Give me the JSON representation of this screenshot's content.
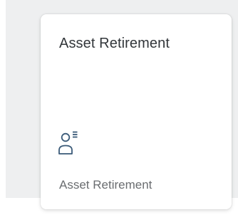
{
  "tile": {
    "title": "Asset Retirement",
    "footer": "Asset Retirement",
    "icon": "user-list-icon"
  },
  "colors": {
    "background": "#eeeff0",
    "tile": "#ffffff",
    "title": "#32363a",
    "footer": "#6a6d70",
    "icon": "#3a5a78"
  }
}
